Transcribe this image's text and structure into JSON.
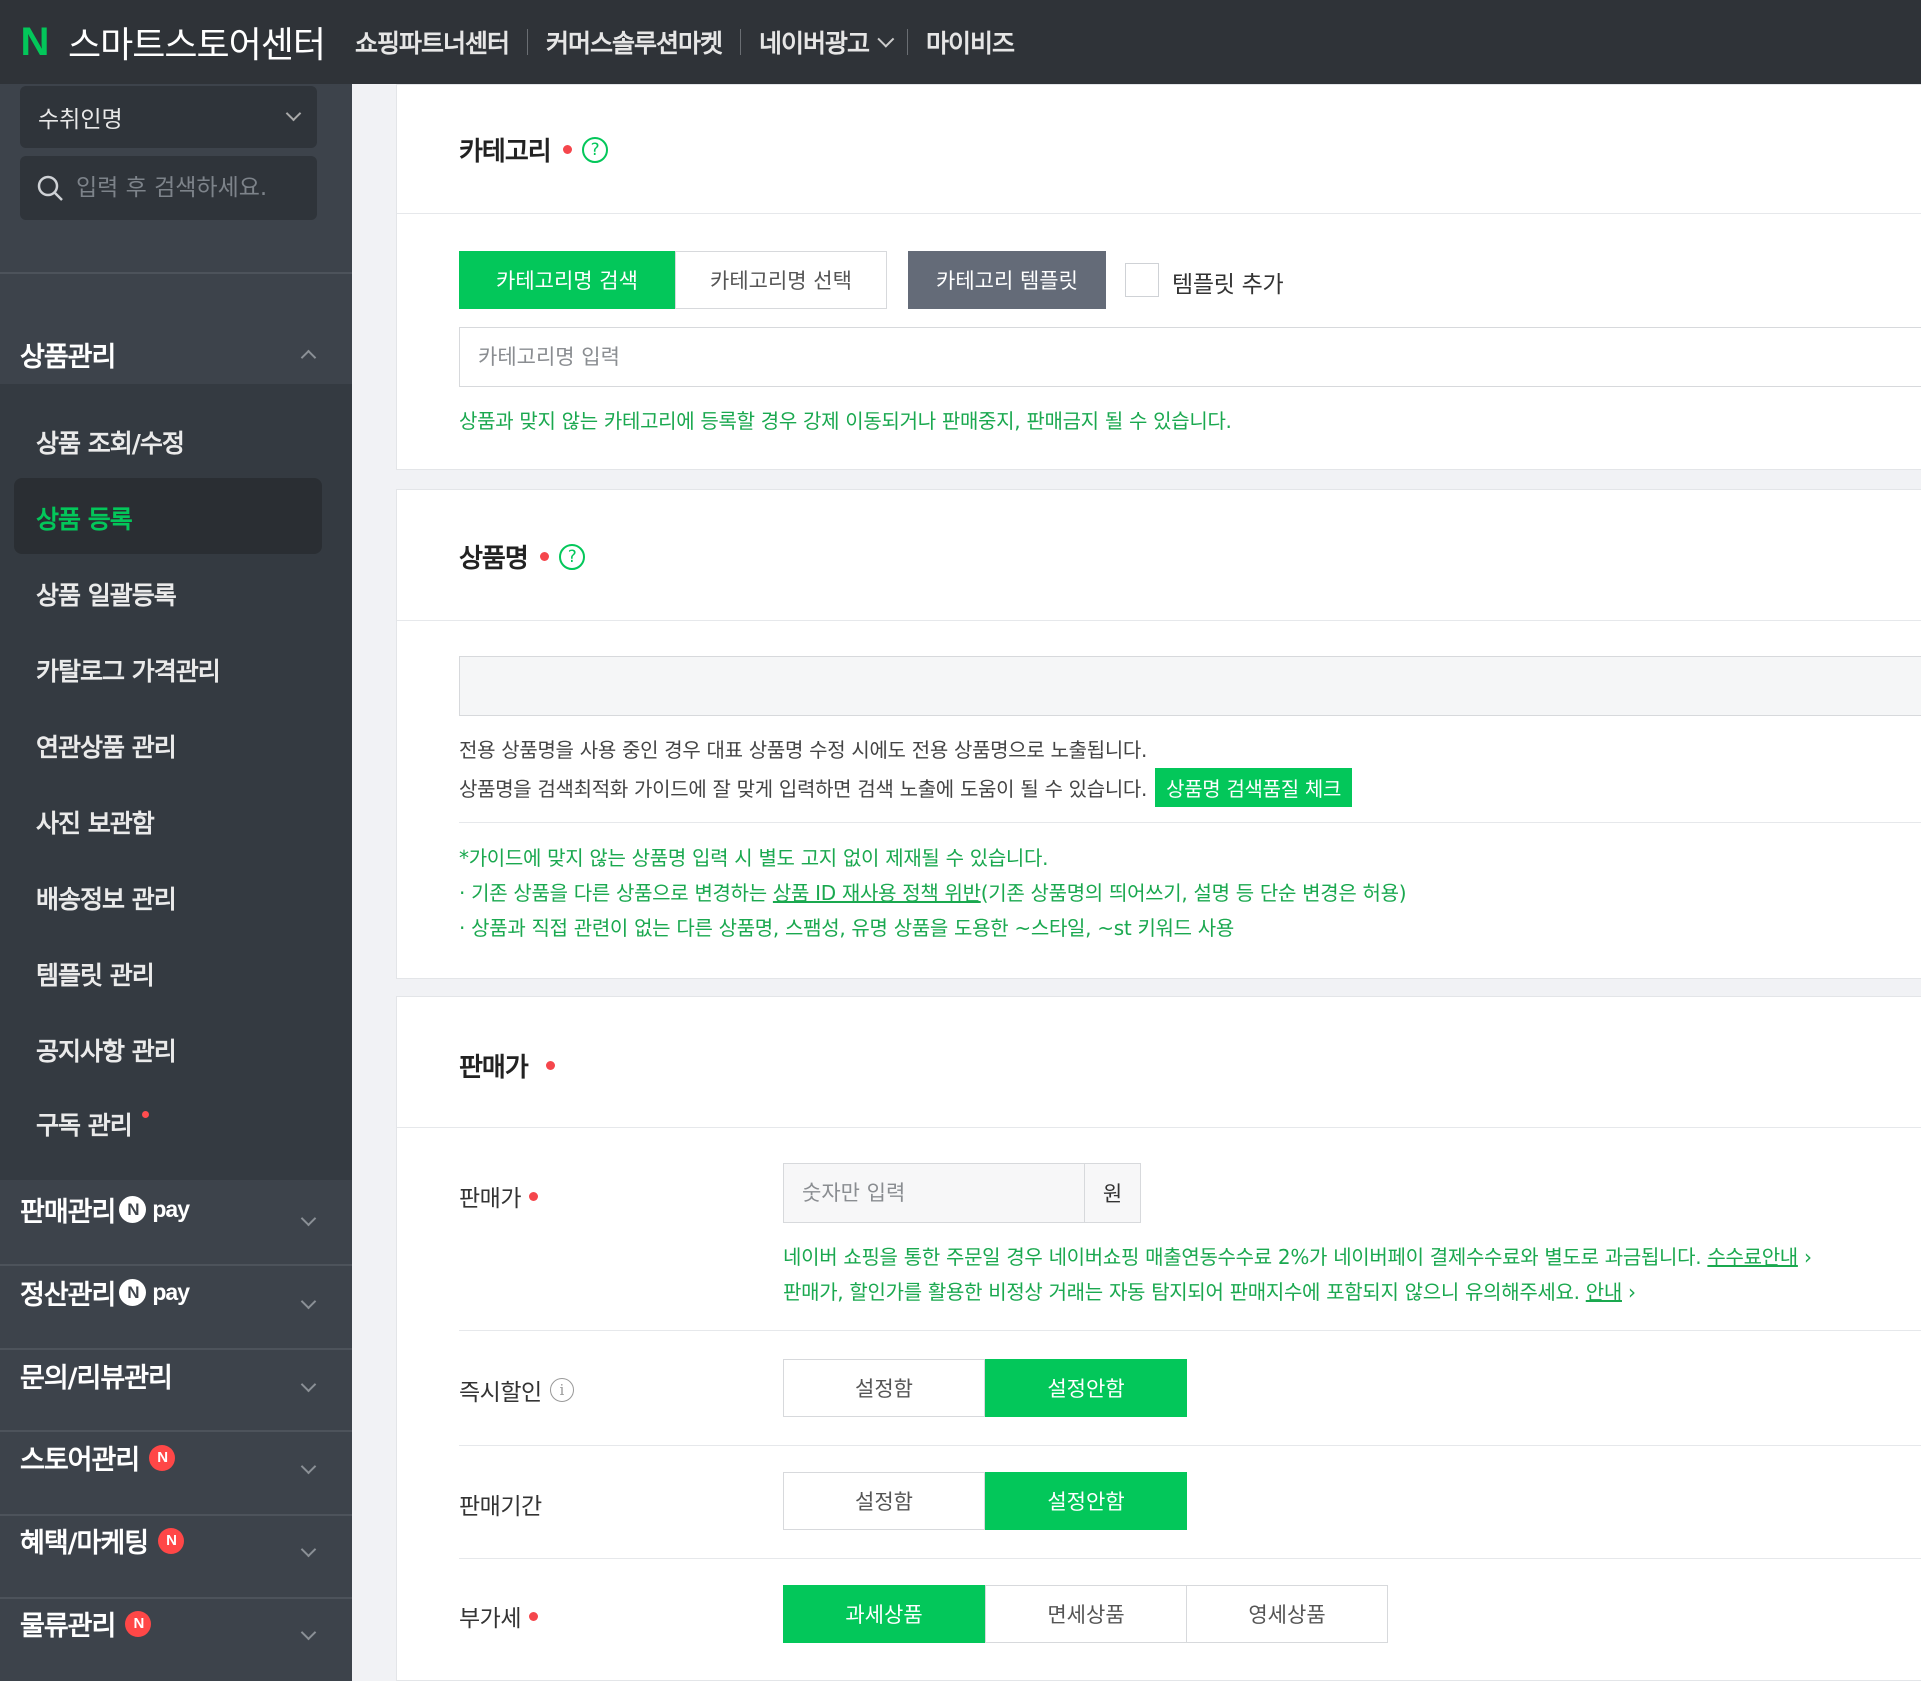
{
  "topbar": {
    "logo": "N",
    "brand": "스마트스토어센터",
    "nav": [
      "쇼핑파트너센터",
      "커머스솔루션마켓",
      "네이버광고",
      "마이비즈"
    ]
  },
  "sidebar": {
    "select_value": "수취인명",
    "search_placeholder": "입력 후 검색하세요.",
    "groups": {
      "product": "상품관리",
      "sales": "판매관리",
      "settlement": "정산관리",
      "inquiry": "문의/리뷰관리",
      "store": "스토어관리",
      "marketing": "혜택/마케팅",
      "logistics": "물류관리"
    },
    "pay_label": "pay",
    "n_badge": "N",
    "sub_items": [
      "상품 조회/수정",
      "상품 등록",
      "상품 일괄등록",
      "카탈로그 가격관리",
      "연관상품 관리",
      "사진 보관함",
      "배송정보 관리",
      "템플릿 관리",
      "공지사항 관리",
      "구독 관리"
    ]
  },
  "category": {
    "title": "카테고리",
    "help": "?",
    "btn_search": "카테고리명 검색",
    "btn_select": "카테고리명 선택",
    "btn_template": "카테고리 템플릿",
    "template_add": "템플릿 추가",
    "input_placeholder": "카테고리명 입력",
    "notice": "상품과 맞지 않는 카테고리에 등록할 경우 강제 이동되거나 판매중지, 판매금지 될 수 있습니다."
  },
  "product_name": {
    "title": "상품명",
    "help": "?",
    "info1": "전용 상품명을 사용 중인 경우 대표 상품명 수정 시에도 전용 상품명으로 노출됩니다.",
    "info2": "상품명을 검색최적화 가이드에 잘 맞게 입력하면 검색 노출에 도움이 될 수 있습니다.",
    "check_btn": "상품명 검색품질 체크",
    "guide1": "*가이드에 맞지 않는 상품명 입력 시 별도 고지 없이 제재될 수 있습니다.",
    "guide2_pre": "· 기존 상품을 다른 상품으로 변경하는 ",
    "guide2_link": "상품 ID 재사용 정책 위반",
    "guide2_post": "(기존 상품명의 띄어쓰기, 설명 등 단순 변경은 허용)",
    "guide3": "· 상품과 직접 관련이 없는 다른 상품명, 스팸성, 유명 상품을 도용한 ~스타일, ~st 키워드 사용"
  },
  "price": {
    "title": "판매가",
    "price_label": "판매가",
    "price_placeholder": "숫자만 입력",
    "currency": "원",
    "notice1": "네이버 쇼핑을 통한 주문일 경우 네이버쇼핑 매출연동수수료 2%가 네이버페이 결제수수료와 별도로 과금됩니다.",
    "notice1_link": "수수료안내",
    "notice2": "판매가, 할인가를 활용한 비정상 거래는 자동 탐지되어 판매지수에 포함되지 않으니 유의해주세요.",
    "notice2_link": "안내",
    "arrow": "›",
    "discount_label": "즉시할인",
    "info_icon": "i",
    "period_label": "판매기간",
    "vat_label": "부가세",
    "set_on": "설정함",
    "set_off": "설정안함",
    "vat_taxable": "과세상품",
    "vat_exempt": "면세상품",
    "vat_zero": "영세상품"
  },
  "colors": {
    "green": "#03c75a",
    "topbar": "#2f3338",
    "sidebar": "#3d434b",
    "required": "#f5464c"
  }
}
